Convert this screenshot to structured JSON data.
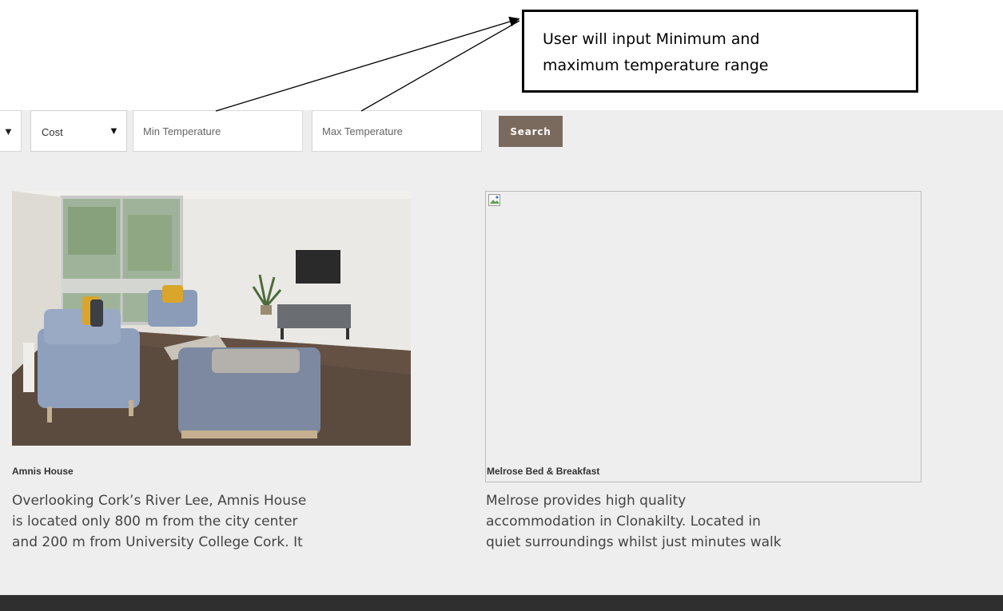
{
  "annotation": {
    "lines": [
      "User will input Minimum and",
      "maximum temperature range"
    ]
  },
  "filters": {
    "cost_select": {
      "value": "Cost"
    },
    "min_temp": {
      "placeholder": "Min Temperature"
    },
    "max_temp": {
      "placeholder": "Max Temperature"
    },
    "search_label": "Search"
  },
  "listings": [
    {
      "title": "Amnis House",
      "description_lines": [
        "Overlooking Cork’s River Lee, Amnis House",
        "is located only 800 m from the city center",
        "and 200 m from University College Cork. It"
      ]
    },
    {
      "title": "Melrose Bed & Breakfast",
      "description_lines": [
        "Melrose provides high quality",
        "accommodation in Clonakilty. Located in",
        "quiet surroundings whilst just minutes walk"
      ]
    }
  ],
  "colors": {
    "panel_bg": "#eeeeee",
    "search_button": "#7a6a5e",
    "footer": "#2f2f2f"
  }
}
